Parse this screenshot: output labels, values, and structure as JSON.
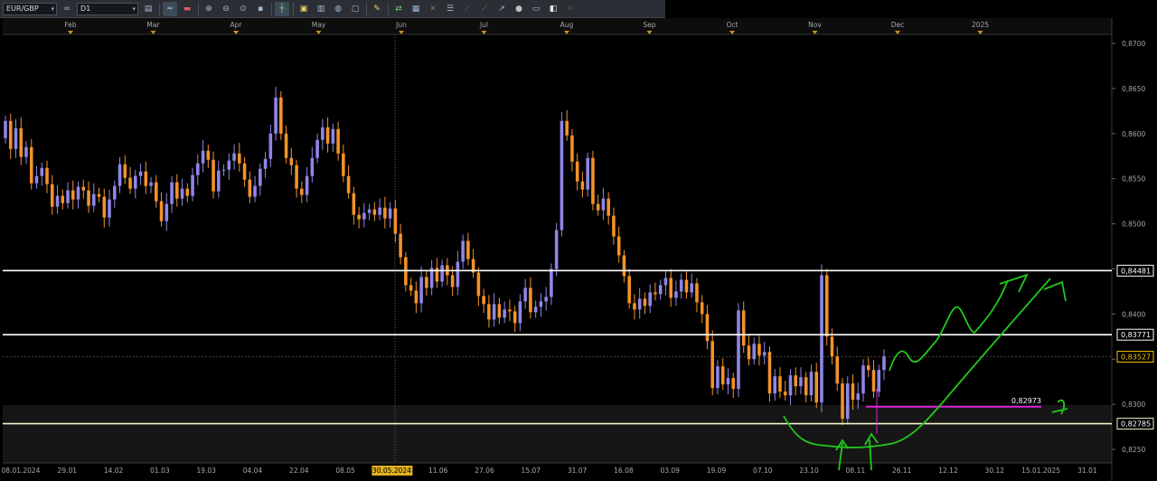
{
  "toolbar": {
    "symbol": "EUR/GBP",
    "timeframe": "D1",
    "buttons": [
      "chart-type-icon",
      "bar-icon",
      "zoom-in-icon",
      "zoom-out-icon",
      "crosshair-icon",
      "line-icon",
      "indicator-icon",
      "template-icon",
      "pen-icon",
      "trade-icon",
      "settings-icon",
      "draw-icon",
      "fib-icon",
      "channel-icon",
      "circle-icon",
      "eraser-icon",
      "more-icon"
    ]
  },
  "chart_data": {
    "type": "candlestick",
    "symbol": "EUR/GBP",
    "timeframe": "D1",
    "ylim": [
      0.8235,
      0.871
    ],
    "y_ticks": [
      "0,8700",
      "0,8650",
      "0,8600",
      "0,8550",
      "0,8500",
      "0,8450",
      "0,8400",
      "0,8350",
      "0,8300",
      "0,8250"
    ],
    "month_labels": [
      "Feb",
      "Mar",
      "Apr",
      "May",
      "Jun",
      "Jul",
      "Aug",
      "Sep",
      "Oct",
      "Nov",
      "Dec",
      "2025"
    ],
    "date_labels": [
      "08.01.2024",
      "29.01",
      "14.02",
      "01.03",
      "19.03",
      "04.04",
      "22.04",
      "08.05",
      "30.05.2024",
      "11.06",
      "27.06",
      "15.07",
      "31.07",
      "16.08",
      "03.09",
      "19.09",
      "07.10",
      "23.10",
      "08.11",
      "26.11",
      "12.12",
      "30.12",
      "15.01.2025",
      "31.01"
    ],
    "crosshair_date": "30.05.2024",
    "price_levels": [
      {
        "value": 0.84481,
        "label": "0,84481",
        "color": "#ffffff"
      },
      {
        "value": 0.83771,
        "label": "0,83771",
        "color": "#ffffff"
      },
      {
        "value": 0.82785,
        "label": "0,82785",
        "color": "#f2f2c8"
      }
    ],
    "current_price": {
      "value": 0.83527,
      "label": "0,83527",
      "color": "#f2c200"
    },
    "target_line": {
      "value": 0.82973,
      "label": "0,82973",
      "color": "#e020e0"
    },
    "up_color": "#8f86e8",
    "down_color": "#f3922a",
    "annotation_color": "#22c81a",
    "candles": [
      [
        0.8595,
        0.8614
      ],
      [
        0.8614,
        0.8583
      ],
      [
        0.8583,
        0.8606
      ],
      [
        0.8606,
        0.8574
      ],
      [
        0.8574,
        0.8585
      ],
      [
        0.8585,
        0.8545
      ],
      [
        0.8545,
        0.8553
      ],
      [
        0.8553,
        0.8562
      ],
      [
        0.8562,
        0.8544
      ],
      [
        0.8544,
        0.8519
      ],
      [
        0.8519,
        0.8531
      ],
      [
        0.8531,
        0.8523
      ],
      [
        0.8523,
        0.8537
      ],
      [
        0.8537,
        0.8527
      ],
      [
        0.8527,
        0.8541
      ],
      [
        0.8541,
        0.8537
      ],
      [
        0.8537,
        0.852
      ],
      [
        0.852,
        0.8533
      ],
      [
        0.8533,
        0.853
      ],
      [
        0.853,
        0.8507
      ],
      [
        0.8507,
        0.8527
      ],
      [
        0.8527,
        0.8542
      ],
      [
        0.8542,
        0.8566
      ],
      [
        0.8566,
        0.8551
      ],
      [
        0.8551,
        0.8539
      ],
      [
        0.8539,
        0.8553
      ],
      [
        0.8553,
        0.8558
      ],
      [
        0.8558,
        0.8542
      ],
      [
        0.8542,
        0.8546
      ],
      [
        0.8546,
        0.8525
      ],
      [
        0.8525,
        0.8503
      ],
      [
        0.8503,
        0.8522
      ],
      [
        0.8522,
        0.8546
      ],
      [
        0.8546,
        0.8528
      ],
      [
        0.8528,
        0.8539
      ],
      [
        0.8539,
        0.8531
      ],
      [
        0.8531,
        0.8554
      ],
      [
        0.8554,
        0.8567
      ],
      [
        0.8567,
        0.8581
      ],
      [
        0.8581,
        0.8571
      ],
      [
        0.8571,
        0.8536
      ],
      [
        0.8536,
        0.8559
      ],
      [
        0.8559,
        0.856
      ],
      [
        0.856,
        0.857
      ],
      [
        0.857,
        0.8578
      ],
      [
        0.8578,
        0.8567
      ],
      [
        0.8567,
        0.8549
      ],
      [
        0.8549,
        0.853
      ],
      [
        0.853,
        0.8542
      ],
      [
        0.8542,
        0.8561
      ],
      [
        0.8561,
        0.8572
      ],
      [
        0.8572,
        0.86
      ],
      [
        0.86,
        0.864
      ],
      [
        0.864,
        0.86
      ],
      [
        0.86,
        0.8573
      ],
      [
        0.8573,
        0.8565
      ],
      [
        0.8565,
        0.8539
      ],
      [
        0.8539,
        0.8532
      ],
      [
        0.8532,
        0.8553
      ],
      [
        0.8553,
        0.8573
      ],
      [
        0.8573,
        0.8593
      ],
      [
        0.8593,
        0.8607
      ],
      [
        0.8607,
        0.8589
      ],
      [
        0.8589,
        0.8605
      ],
      [
        0.8605,
        0.8578
      ],
      [
        0.8578,
        0.8553
      ],
      [
        0.8553,
        0.8534
      ],
      [
        0.8534,
        0.851
      ],
      [
        0.851,
        0.8505
      ],
      [
        0.8505,
        0.8512
      ],
      [
        0.8512,
        0.8516
      ],
      [
        0.8516,
        0.851
      ],
      [
        0.851,
        0.8518
      ],
      [
        0.8518,
        0.8506
      ],
      [
        0.8506,
        0.8517
      ],
      [
        0.8517,
        0.8489
      ],
      [
        0.8489,
        0.8463
      ],
      [
        0.8463,
        0.8432
      ],
      [
        0.8432,
        0.8426
      ],
      [
        0.8426,
        0.8412
      ],
      [
        0.8412,
        0.8441
      ],
      [
        0.8441,
        0.8429
      ],
      [
        0.8429,
        0.8451
      ],
      [
        0.8451,
        0.8436
      ],
      [
        0.8436,
        0.8454
      ],
      [
        0.8454,
        0.8443
      ],
      [
        0.8443,
        0.843
      ],
      [
        0.843,
        0.8458
      ],
      [
        0.8458,
        0.8481
      ],
      [
        0.8481,
        0.8461
      ],
      [
        0.8461,
        0.8446
      ],
      [
        0.8446,
        0.842
      ],
      [
        0.842,
        0.8411
      ],
      [
        0.8411,
        0.8394
      ],
      [
        0.8394,
        0.8411
      ],
      [
        0.8411,
        0.8396
      ],
      [
        0.8396,
        0.8405
      ],
      [
        0.8405,
        0.8403
      ],
      [
        0.8403,
        0.839
      ],
      [
        0.839,
        0.8414
      ],
      [
        0.8414,
        0.8429
      ],
      [
        0.8429,
        0.8402
      ],
      [
        0.8402,
        0.8408
      ],
      [
        0.8408,
        0.8414
      ],
      [
        0.8414,
        0.8419
      ],
      [
        0.8419,
        0.845
      ],
      [
        0.845,
        0.8493
      ],
      [
        0.8493,
        0.8614
      ],
      [
        0.8614,
        0.8598
      ],
      [
        0.8598,
        0.8569
      ],
      [
        0.8569,
        0.8547
      ],
      [
        0.8547,
        0.8538
      ],
      [
        0.8538,
        0.8573
      ],
      [
        0.8573,
        0.8522
      ],
      [
        0.8522,
        0.8515
      ],
      [
        0.8515,
        0.8528
      ],
      [
        0.8528,
        0.8509
      ],
      [
        0.8509,
        0.8486
      ],
      [
        0.8486,
        0.8465
      ],
      [
        0.8465,
        0.8442
      ],
      [
        0.8442,
        0.8412
      ],
      [
        0.8412,
        0.8405
      ],
      [
        0.8405,
        0.8417
      ],
      [
        0.8417,
        0.8409
      ],
      [
        0.8409,
        0.8424
      ],
      [
        0.8424,
        0.8422
      ],
      [
        0.8422,
        0.8432
      ],
      [
        0.8432,
        0.844
      ],
      [
        0.844,
        0.8418
      ],
      [
        0.8418,
        0.8425
      ],
      [
        0.8425,
        0.8438
      ],
      [
        0.8438,
        0.8424
      ],
      [
        0.8424,
        0.8434
      ],
      [
        0.8434,
        0.8413
      ],
      [
        0.8413,
        0.84
      ],
      [
        0.84,
        0.837
      ],
      [
        0.837,
        0.8318
      ],
      [
        0.8318,
        0.8342
      ],
      [
        0.8342,
        0.8322
      ],
      [
        0.8322,
        0.8329
      ],
      [
        0.8329,
        0.8317
      ],
      [
        0.8317,
        0.8404
      ],
      [
        0.8404,
        0.8365
      ],
      [
        0.8365,
        0.835
      ],
      [
        0.835,
        0.8367
      ],
      [
        0.8367,
        0.8354
      ],
      [
        0.8354,
        0.8358
      ],
      [
        0.8358,
        0.8312
      ],
      [
        0.8312,
        0.8331
      ],
      [
        0.8331,
        0.8314
      ],
      [
        0.8314,
        0.831
      ],
      [
        0.831,
        0.8332
      ],
      [
        0.8332,
        0.832
      ],
      [
        0.832,
        0.833
      ],
      [
        0.833,
        0.831
      ],
      [
        0.831,
        0.8336
      ],
      [
        0.8336,
        0.8302
      ],
      [
        0.8302,
        0.8443
      ],
      [
        0.8443,
        0.8375
      ],
      [
        0.8375,
        0.8353
      ],
      [
        0.8353,
        0.8323
      ],
      [
        0.8323,
        0.8284
      ],
      [
        0.8284,
        0.8323
      ],
      [
        0.8323,
        0.8305
      ],
      [
        0.8305,
        0.8312
      ],
      [
        0.8312,
        0.8343
      ],
      [
        0.8343,
        0.8338
      ],
      [
        0.8338,
        0.8314
      ],
      [
        0.8314,
        0.8338
      ],
      [
        0.8338,
        0.8353
      ]
    ]
  }
}
